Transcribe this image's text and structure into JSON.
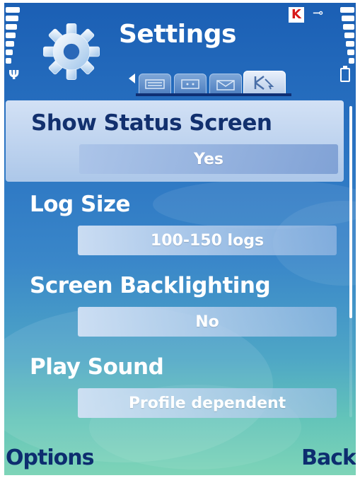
{
  "header": {
    "title": "Settings"
  },
  "tabs": [
    {
      "icon": "keyboard-icon"
    },
    {
      "icon": "card-icon"
    },
    {
      "icon": "envelope-icon"
    },
    {
      "icon": "kaspersky-k-icon",
      "active": true
    }
  ],
  "settings": [
    {
      "label": "Show Status Screen",
      "value": "Yes",
      "selected": true
    },
    {
      "label": "Log Size",
      "value": "100-150 logs"
    },
    {
      "label": "Screen Backlighting",
      "value": "No"
    },
    {
      "label": "Play Sound",
      "value": "Profile dependent"
    }
  ],
  "softkeys": {
    "left": "Options",
    "right": "Back"
  },
  "colors": {
    "label_selected": "#12306e",
    "softkey": "#0d2d6f",
    "alert_k": "#d81818"
  }
}
